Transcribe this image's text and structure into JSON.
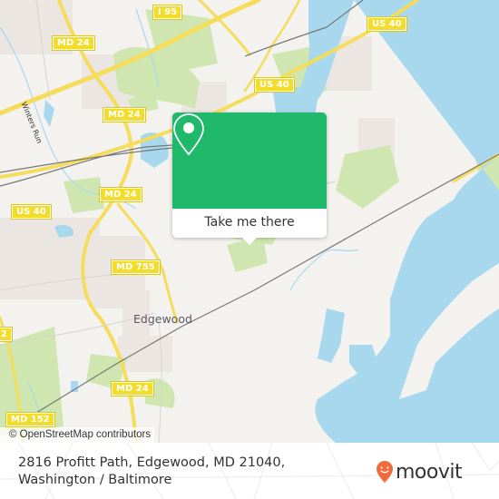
{
  "map": {
    "road_shields": [
      {
        "id": "i95",
        "label": "I 95"
      },
      {
        "id": "md24-top",
        "label": "MD 24"
      },
      {
        "id": "md24-mid",
        "label": "MD 24"
      },
      {
        "id": "md24-lower",
        "label": "MD 24"
      },
      {
        "id": "md24-bottom",
        "label": "MD 24"
      },
      {
        "id": "us40-right-top",
        "label": "US 40"
      },
      {
        "id": "us40-center",
        "label": "US 40"
      },
      {
        "id": "us40-left",
        "label": "US 40"
      },
      {
        "id": "md755",
        "label": "MD 755"
      },
      {
        "id": "md152",
        "label": "MD 152"
      },
      {
        "id": "md152-partial",
        "label": "2"
      }
    ],
    "place_labels": {
      "edgewood": "Edgewood",
      "winters_run": "Winters Run"
    },
    "attribution": "© OpenStreetMap contributors",
    "colors": {
      "land": "#f3f2ef",
      "water": "#a8d8ee",
      "park": "#cfe6b0",
      "residential": "#ebe6e2",
      "road": "#f5dc5a",
      "popup_green": "#20b86a"
    }
  },
  "popup": {
    "icon": "location-pin-icon",
    "button_label": "Take me there"
  },
  "footer": {
    "address_line1": "2816 Profitt Path, Edgewood, MD 21040,",
    "address_line2": "Washington / Baltimore",
    "logo_text": "moovit",
    "logo_color": "#f26a3a"
  }
}
